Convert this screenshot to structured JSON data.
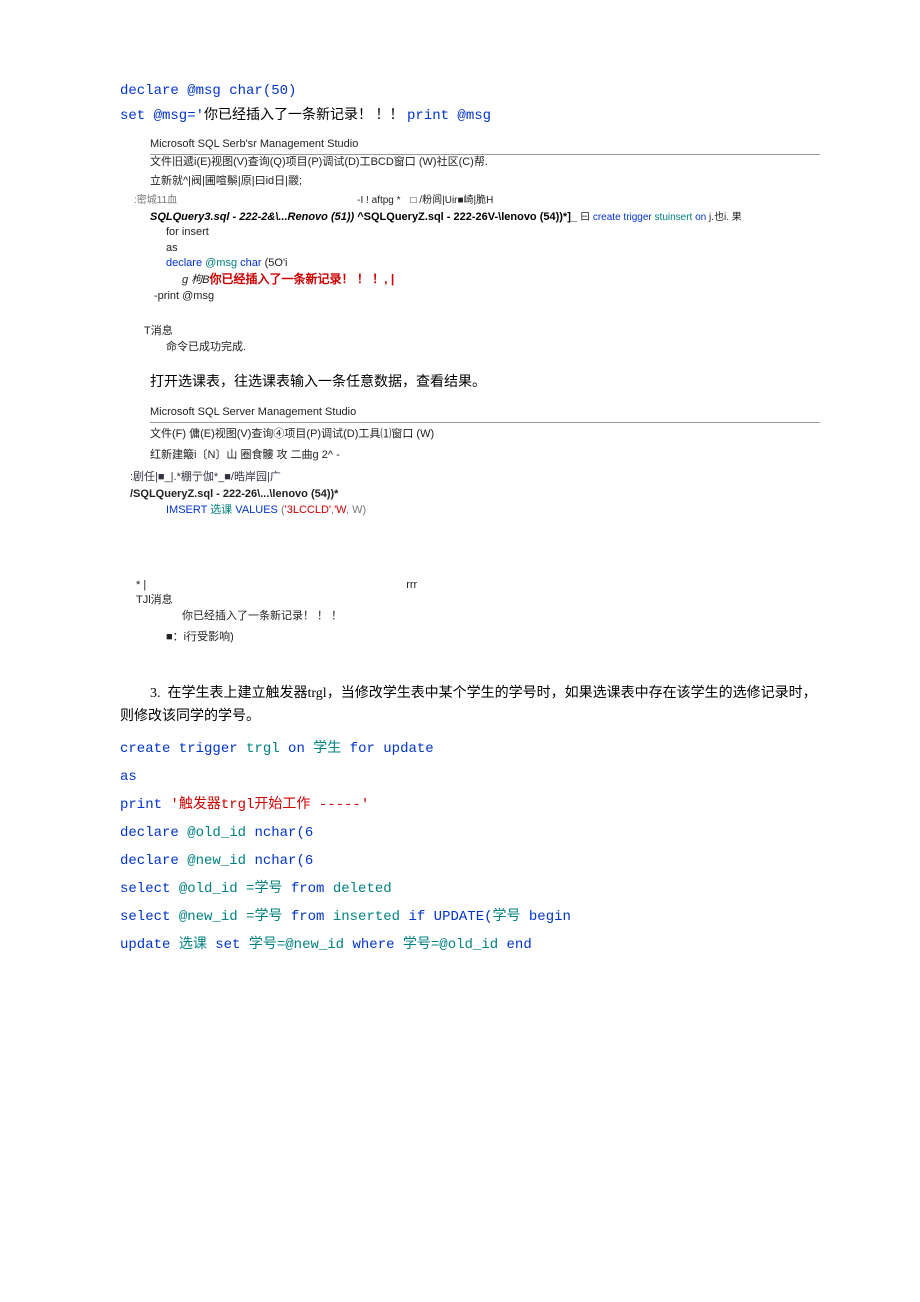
{
  "intro": {
    "line1": "declare @msg char(50)",
    "line2_pre": "set @msg='",
    "line2_cn": "你已经插入了一条新记录！ ！！ ",
    "line2_post": "print @msg"
  },
  "ssms1": {
    "title": "Microsoft SQL Serb'sr Management Studio",
    "menu": "文件旧遞i(E)视图(V)查询(Q)项目(P)调试(D)工BCD窗口 (W)社区(C)帮.",
    "toolbar": "立新就^|阀|圃喧鬃|原|曰id日|鬷;",
    "bar_left": ":密城11血",
    "bar_mid": "-I ! aftpg *",
    "bar_right": "□ /粉闾|Uir■崎|脆H",
    "tab_label_a": "SQLQuery3.sql - 222-2&\\...Renovo (51))",
    "tab_label_b": " ^SQLQueryZ.sql - 222-26V-\\lenovo (54))*]_",
    "code_pre": "曰 ",
    "code_1a": "create trigger",
    "code_1b": " stuinsert ",
    "code_1c": "on",
    "code_1d": " j.也i. 果",
    "code_2": "for insert",
    "code_3": "as",
    "code_4a": "declare",
    "code_4b": " @msg ",
    "code_4c": "char",
    "code_4d": " (5O'i",
    "code_5a": "g 枸B",
    "code_5b": "你已经插入了一条新记录！ ！ ！, |",
    "code_6": "-print @msg",
    "msg_header": "T消息",
    "msg_body": "命令已成功完成."
  },
  "narrative1": "打开选课表，往选课表输入一条任意数据，查看结果。",
  "ssms2": {
    "title": "Microsoft SQL Server Management Studio",
    "menu": "文件(F) 傭(E)视图(V)查询④项目(P)调试(D)工具⑴窗口 (W)",
    "toolbar": "红新建簸i〔N〕山 圈食髏 攻 二曲g 2^ -",
    "bar": ":剧任|■_|.*棚亍伽*_■/晧岸园|广",
    "tab_label": "/SQLQueryZ.sql - 222-26\\...\\lenovo (54))*",
    "code_1a": "IMSERT",
    "code_1b": " 选课 ",
    "code_1c": "VALUES",
    "code_1d": " (",
    "code_1e": "'3LCCLD'",
    "code_1f": ",",
    "code_1g": "'W",
    "code_1h": ", W",
    "code_1i": ")",
    "spacer_l": "* |",
    "spacer_r": "rrr",
    "msg_header": "TJl消息",
    "msg_line1": "你已经插入了一条新记录！ ！ ！",
    "msg_line2": "■：i行受影响)"
  },
  "q3": {
    "num": "3.",
    "text": "在学生表上建立触发器trgl，当修改学生表中某个学生的学号时，如果选课表中存在该学生的选修记录时，则修改该同学的学号。"
  },
  "code3": {
    "l1a": "create trigger",
    "l1b": " trgl ",
    "l1c": "on",
    "l1d": " 学生 ",
    "l1e": "for update",
    "l2": "as",
    "l3a": "print",
    "l3b": " '触发器trgl开始工作 -----'",
    "l4a": "declare",
    "l4b": " @old_id ",
    "l4c": "nchar(6",
    "l5a": "declare",
    "l5b": " @new_id ",
    "l5c": "nchar(6",
    "l6a": "select",
    "l6b": " @old_id =",
    "l6c": "学号 ",
    "l6d": "from",
    "l6e": " deleted",
    "l7a": "select",
    "l7b": " @new_id =",
    "l7c": "学号 ",
    "l7d": "from",
    "l7e": " inserted ",
    "l7f": "if",
    "l7g": " UPDATE(",
    "l7h": "学号 ",
    "l7i": "begin",
    "l8a": "update",
    "l8b": " 选课 ",
    "l8c": "set",
    "l8d": " 学号",
    "l8e": "=@new_id ",
    "l8f": "where",
    "l8g": " 学号",
    "l8h": "=@old_id ",
    "l8i": "end"
  }
}
